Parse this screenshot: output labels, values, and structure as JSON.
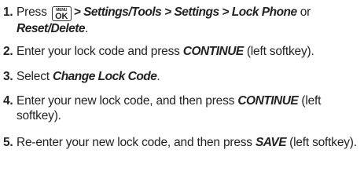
{
  "steps": [
    {
      "num": "1.",
      "press": "Press",
      "key_top": "MENU",
      "key_main": "OK",
      "path": "> Settings/Tools > Settings > Lock Phone",
      "or": "or",
      "alt": "Reset/Delete",
      "end": "."
    },
    {
      "num": "2.",
      "text": "Enter your lock code and press",
      "em": "CONTINUE",
      "tail": "(left softkey)."
    },
    {
      "num": "3.",
      "text": "Select",
      "em": "Change Lock Code",
      "tail": "."
    },
    {
      "num": "4.",
      "text": "Enter your new lock code, and then press",
      "em": "CONTINUE",
      "tail": "(left softkey)."
    },
    {
      "num": "5.",
      "text": "Re-enter your new lock code, and then press",
      "em": "SAVE",
      "tail": "(left softkey)."
    }
  ]
}
